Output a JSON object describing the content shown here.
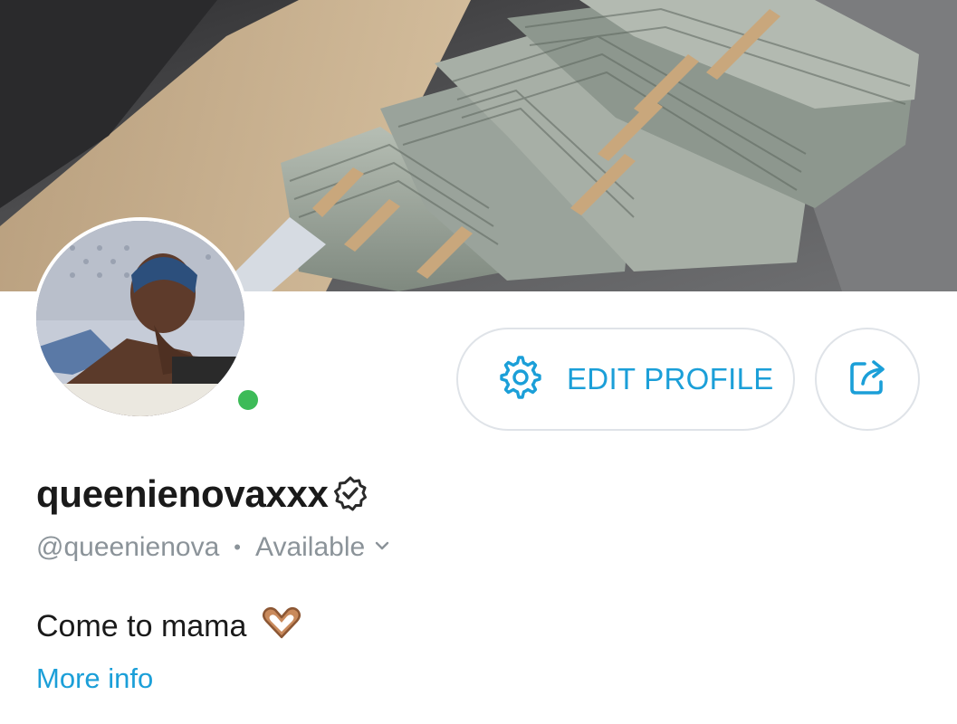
{
  "profile": {
    "display_name": "queenienovaxxx",
    "handle": "@queenienova",
    "separator": "•",
    "status": "Available",
    "bio": "Come to mama",
    "bio_emoji": "heart-hands-emoji",
    "more_info": "More info",
    "online": true
  },
  "actions": {
    "edit_profile_label": "EDIT PROFILE",
    "edit_icon": "gear-icon",
    "share_icon": "share-icon"
  },
  "colors": {
    "accent": "#1b9fd8",
    "online": "#3dbb58",
    "muted": "#8b9399",
    "text": "#1a1a1a"
  }
}
